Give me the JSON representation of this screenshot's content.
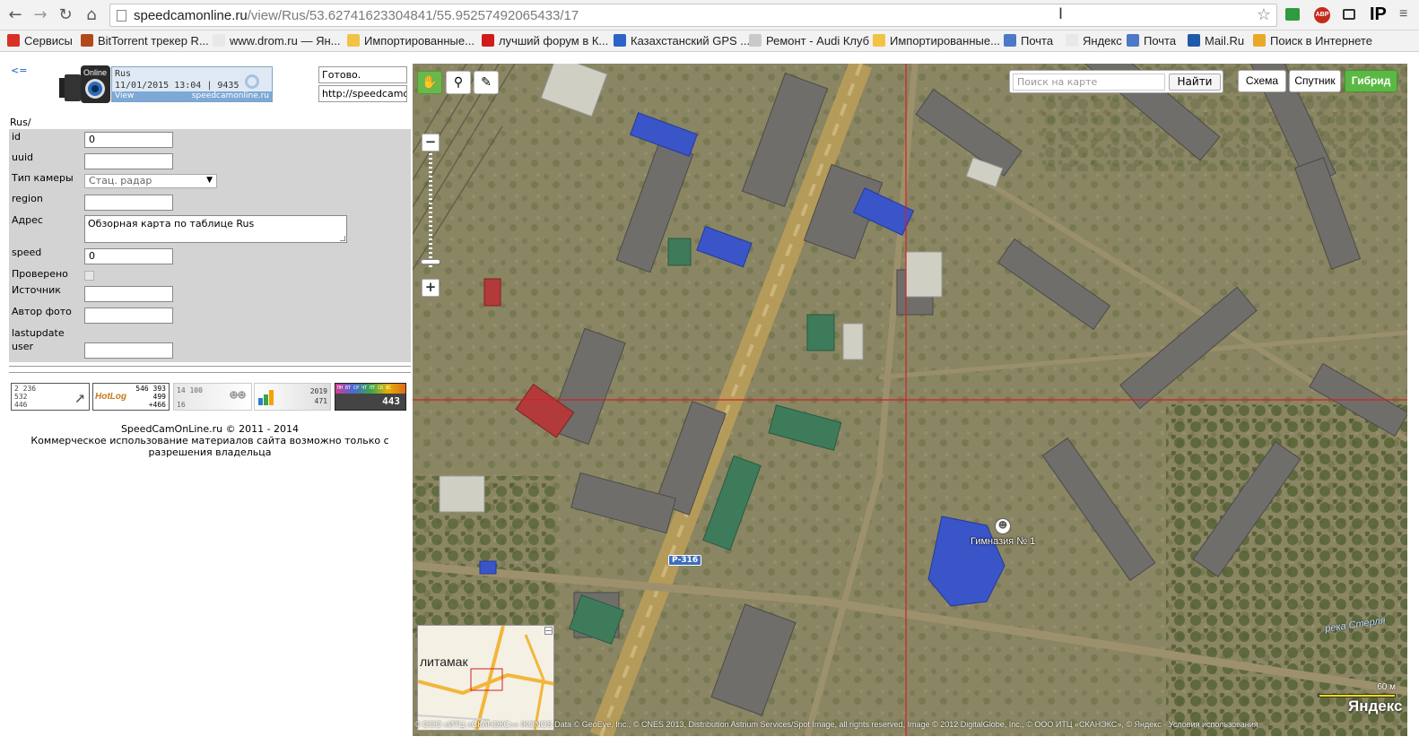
{
  "browser": {
    "url_host": "speedcamonline.ru",
    "url_path": "/view/Rus/53.62741623304841/55.95257492065433/17",
    "extensions": {
      "abp": "ABP",
      "ip": "IP"
    }
  },
  "bookmarks": [
    {
      "label": "Сервисы",
      "icon_color": "#d93025"
    },
    {
      "label": "BitTorrent трекер R...",
      "icon_color": "#b04a1a"
    },
    {
      "label": "www.drom.ru — Ян...",
      "icon_color": "#e8e8e8"
    },
    {
      "label": "Импортированные...",
      "icon_color": "#f2c244"
    },
    {
      "label": "лучший форум в К...",
      "icon_color": "#d11b1b"
    },
    {
      "label": "Казахстанский GPS ...",
      "icon_color": "#2b63c8"
    },
    {
      "label": "Ремонт - Audi Клуб",
      "icon_color": "#c9c9c9"
    },
    {
      "label": "Импортированные...",
      "icon_color": "#f2c244"
    },
    {
      "label": "Почта",
      "icon_color": "#4d79c7"
    },
    {
      "label": "Яндекс",
      "icon_color": "#e8e8e8"
    },
    {
      "label": "Почта",
      "icon_color": "#4d79c7"
    },
    {
      "label": "Mail.Ru",
      "icon_color": "#1f5aa8"
    },
    {
      "label": "Поиск в Интернете",
      "icon_color": "#e9a928"
    }
  ],
  "left_panel": {
    "back_link": "<=",
    "info": {
      "country": "Rus",
      "datetime": "11/01/2015 13:04",
      "count": "9435",
      "view": "View",
      "site": "speedcamonline.ru",
      "logo_text": "Online"
    },
    "status": "Готово.",
    "link_field": "http://speedcamonline.ru",
    "path": "Rus/",
    "fields": {
      "id_label": "id",
      "id_value": "0",
      "uuid_label": "uuid",
      "uuid_value": "",
      "camera_type_label": "Тип камеры",
      "camera_type_value": "Стац. радар",
      "region_label": "region",
      "region_value": "",
      "address_label": "Адрес",
      "address_value": "Обзорная карта по таблице Rus",
      "speed_label": "speed",
      "speed_value": "0",
      "checked_label": "Проверено",
      "source_label": "Источник",
      "source_value": "",
      "photo_author_label": "Автор фото",
      "photo_author_value": "",
      "lastupdate_label": "lastupdate",
      "user_label": "user",
      "user_value": ""
    },
    "counters": {
      "c1_line1": "2 236",
      "c1_line2": "532",
      "c1_line3": "446",
      "hotlog": "HotLog",
      "c2_line1": "546 393",
      "c2_line2": "499",
      "c2_line3": "+466",
      "c3_line1": "14 100",
      "c3_line2": "16",
      "c4_line1": "2019",
      "c4_line2": "471",
      "c5_days": "ПН ВТ СР ЧТ ПТ СБ ВС",
      "c5_value": "443"
    },
    "footer": {
      "line1": "SpeedCamOnLine.ru © 2011 - 2014",
      "line2": "Коммерческое использование материалов сайта возможно только с разрешения владельца"
    }
  },
  "map": {
    "search_placeholder": "Поиск на карте",
    "search_button": "Найти",
    "types": [
      "Схема",
      "Спутник",
      "Гибрид"
    ],
    "active_type": "Гибрид",
    "road_label": "Р-316",
    "school_label": "Гимназия № 1",
    "river_label": "река Стерля",
    "overview_city": "литамак",
    "scale_label": "60 м",
    "logo": "Яндекс",
    "copyright": "© ООО «ИТЦ «СКАНЭКС»» IKONOS Data © GeoEye, Inc., © CNES 2013, Distribution Astrium Services/Spot Image, all rights reserved, Image © 2012 DigitalGlobe, Inc., © ООО ИТЦ «СКАНЭКС», © Яндекс · Условия использования",
    "colors": {
      "crosshair": "#d42020",
      "active_green": "#5bb844",
      "building_blue": "#3a55c8"
    }
  }
}
